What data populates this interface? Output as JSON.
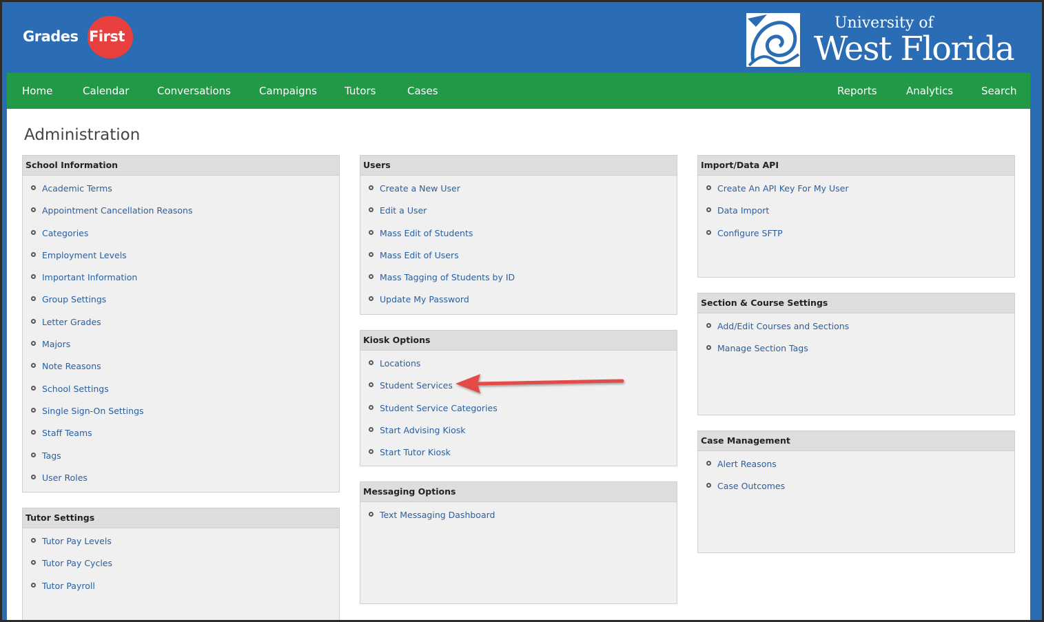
{
  "brand": {
    "logo_part1": "Grades",
    "logo_part2": "First",
    "logo_accent": "#e8403f",
    "university_line1": "University of",
    "university_line2": "West Florida"
  },
  "colors": {
    "header_bg": "#2a6db4",
    "nav_bg": "#229946",
    "link": "#2a5f9e",
    "annotation_arrow": "#e24b47"
  },
  "nav": {
    "left": [
      "Home",
      "Calendar",
      "Conversations",
      "Campaigns",
      "Tutors",
      "Cases"
    ],
    "right": [
      "Reports",
      "Analytics",
      "Search"
    ]
  },
  "page_title": "Administration",
  "panels": {
    "school_information": {
      "title": "School Information",
      "items": [
        "Academic Terms",
        "Appointment Cancellation Reasons",
        "Categories",
        "Employment Levels",
        "Important Information",
        "Group Settings",
        "Letter Grades",
        "Majors",
        "Note Reasons",
        "School Settings",
        "Single Sign-On Settings",
        "Staff Teams",
        "Tags",
        "User Roles"
      ]
    },
    "tutor_settings": {
      "title": "Tutor Settings",
      "items": [
        "Tutor Pay Levels",
        "Tutor Pay Cycles",
        "Tutor Payroll"
      ]
    },
    "users": {
      "title": "Users",
      "items": [
        "Create a New User",
        "Edit a User",
        "Mass Edit of Students",
        "Mass Edit of Users",
        "Mass Tagging of Students by ID",
        "Update My Password"
      ]
    },
    "kiosk_options": {
      "title": "Kiosk Options",
      "items": [
        "Locations",
        "Student Services",
        "Student Service Categories",
        "Start Advising Kiosk",
        "Start Tutor Kiosk"
      ]
    },
    "messaging_options": {
      "title": "Messaging Options",
      "items": [
        "Text Messaging Dashboard"
      ]
    },
    "import_data_api": {
      "title": "Import/Data API",
      "items": [
        "Create An API Key For My User",
        "Data Import",
        "Configure SFTP"
      ]
    },
    "section_course_settings": {
      "title": "Section & Course Settings",
      "items": [
        "Add/Edit Courses and Sections",
        "Manage Section Tags"
      ]
    },
    "case_management": {
      "title": "Case Management",
      "items": [
        "Alert Reasons",
        "Case Outcomes"
      ]
    }
  }
}
